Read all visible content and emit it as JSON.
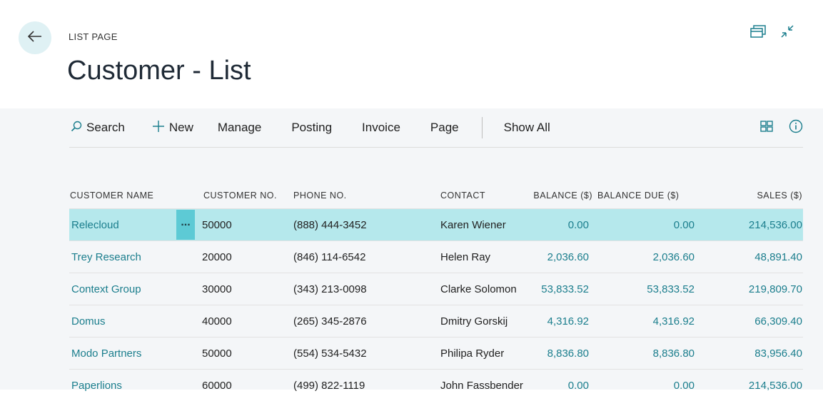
{
  "header": {
    "kicker": "LIST PAGE",
    "title": "Customer - List"
  },
  "icons": {
    "back": "back-arrow-icon",
    "popout": "open-in-new-window-icon",
    "collapse": "collapse-icon",
    "search": "search-icon",
    "new": "plus-icon",
    "layout": "grid-view-icon",
    "info": "info-icon"
  },
  "actions": {
    "search": "Search",
    "new": "New",
    "manage": "Manage",
    "posting": "Posting",
    "invoice": "Invoice",
    "page": "Page",
    "show_all": "Show All"
  },
  "table": {
    "columns": {
      "name": "CUSTOMER NAME",
      "no": "CUSTOMER NO.",
      "phone": "PHONE NO.",
      "contact": "CONTACT",
      "balance": "BALANCE ($)",
      "balance_due": "BALANCE DUE ($)",
      "sales": "SALES ($)"
    },
    "rows": [
      {
        "name": "Relecloud",
        "no": "50000",
        "phone": "(888) 444-3452",
        "contact": "Karen Wiener",
        "balance": "0.00",
        "balance_due": "0.00",
        "sales": "214,536.00"
      },
      {
        "name": "Trey Research",
        "no": "20000",
        "phone": "(846) 114-6542",
        "contact": "Helen Ray",
        "balance": "2,036.60",
        "balance_due": "2,036.60",
        "sales": "48,891.40"
      },
      {
        "name": "Context Group",
        "no": "30000",
        "phone": "(343) 213-0098",
        "contact": "Clarke Solomon",
        "balance": "53,833.52",
        "balance_due": "53,833.52",
        "sales": "219,809.70"
      },
      {
        "name": "Domus",
        "no": "40000",
        "phone": "(265) 345-2876",
        "contact": "Dmitry Gorskij",
        "balance": "4,316.92",
        "balance_due": "4,316.92",
        "sales": "66,309.40"
      },
      {
        "name": "Modo Partners",
        "no": "50000",
        "phone": "(554) 534-5432",
        "contact": "Philipa Ryder",
        "balance": "8,836.80",
        "balance_due": "8,836.80",
        "sales": "83,956.40"
      },
      {
        "name": "Paperlions",
        "no": "60000",
        "phone": "(499) 822-1119",
        "contact": "John Fassbender",
        "balance": "0.00",
        "balance_due": "0.00",
        "sales": "214,536.00"
      }
    ],
    "row_menu": "..."
  },
  "colors": {
    "accent": "#1b7e8d",
    "selected_row": "#b5e8ec",
    "row_menu": "#5dcad5",
    "back_button": "#dff1f4",
    "content_bg": "#f4f6f8"
  }
}
